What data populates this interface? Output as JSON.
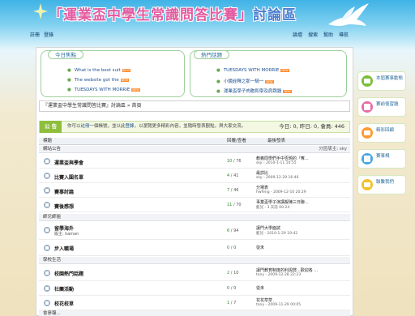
{
  "banner": {
    "title_open": "「",
    "title_main": "運業盃中學生常識問答比賽",
    "title_close": "」",
    "title_suffix": "討論區"
  },
  "toplinks": {
    "register": "註冊",
    "login": "登錄"
  },
  "topnav": [
    "論壇",
    "搜索",
    "幫助",
    "導航"
  ],
  "news_today": {
    "heading": "今日焦點",
    "items": [
      {
        "text": "What is the best suit",
        "badge": "NEW"
      },
      {
        "text": "The website got the",
        "badge": "NEW"
      },
      {
        "text": "TUESDAYS WITH MORRIE",
        "badge": "NEW"
      }
    ]
  },
  "news_hot": {
    "heading": "熱門話題",
    "items": [
      {
        "text": "TUESDAYS WITH MORRIE",
        "badge": "NEW"
      },
      {
        "text": "小鏡詮釋之那一騎一",
        "badge": "NEW"
      },
      {
        "text": "運業盃學子肉胞和學及肩跳題",
        "badge": "NEW"
      }
    ]
  },
  "breadcrumb": "『運業盃中學生常識問答比賽』討論區 » 首頁",
  "info_bar": {
    "tag": "公 告",
    "text_before": "你可以",
    "register": "註冊",
    "text_mid": "一個帳號，並以此",
    "login": "登錄",
    "text_after": "，以瀏覽更多精彩內容，並隨時發表觀點，與大家交流。",
    "stats": "今日: 0, 昨日: 0, 會員: 446"
  },
  "forum": {
    "col_forum": "標題",
    "col_count": "回覆/查看",
    "col_last": "最後發表",
    "moderator_label": "分區版主:",
    "moderator": "sky",
    "categories": [
      {
        "name": "網站公告",
        "rows": [
          {
            "name": "運業盃與學會",
            "count_a": "10",
            "count_b": "76",
            "lp1": "教義問學們手中否題的『奪...",
            "lp2": "sky - 2010-1-11 10:55"
          },
          {
            "name": "比賽入圍名單",
            "count_a": "4",
            "count_b": "41",
            "lp1": "最詳比",
            "lp2": "sky - 2009-12-29 16:46"
          },
          {
            "name": "賽事討論",
            "count_a": "7",
            "count_b": "46",
            "lp1": "分場表",
            "lp2": "hwfeng - 2009-12-10 20:29"
          },
          {
            "name": "賽後感想",
            "count_a": "11",
            "count_b": "70",
            "lp1": "事業盃學子演講擬陳三日聯...",
            "lp2": "藍兒 - 3 天前 00:24"
          }
        ]
      },
      {
        "name": "師兄師姐",
        "rows": [
          {
            "name": "留學海外",
            "mod": "版主: kaman",
            "count_a": "6",
            "count_b": "94",
            "lp1": "讓門大學面試",
            "lp2": "藍兒 - 2010-1-29 19:42"
          },
          {
            "name": "步入職場",
            "count_a": "0",
            "count_b": "0",
            "lp1": "從未",
            "lp2": ""
          }
        ]
      },
      {
        "name": "學校生活",
        "rows": [
          {
            "name": "校園熱門話題",
            "count_a": "2",
            "count_b": "10",
            "lp1": "讓門教育制度的利與弊...歡迎各 ...",
            "lp2": "tony - 2009-12-28 22:23"
          },
          {
            "name": "社團活動",
            "count_a": "0",
            "count_b": "0",
            "lp1": "從未",
            "lp2": ""
          },
          {
            "name": "校花校草",
            "count_a": "1",
            "count_b": "7",
            "lp1": "花花草草",
            "lp2": "tony - 2009-11-29 00:05"
          }
        ]
      },
      {
        "name": "會參報...",
        "rows": []
      }
    ]
  },
  "sidebar": [
    {
      "label": "本屆賽事動態",
      "color": "#7bbf3a"
    },
    {
      "label": "賽前復習題",
      "color": "#e96aa3"
    },
    {
      "label": "精彩回顧",
      "color": "#ff9a2e"
    },
    {
      "label": "賽事規",
      "color": "#4aa6e0"
    },
    {
      "label": "聯繫我們",
      "color": "#f2c12e"
    }
  ]
}
